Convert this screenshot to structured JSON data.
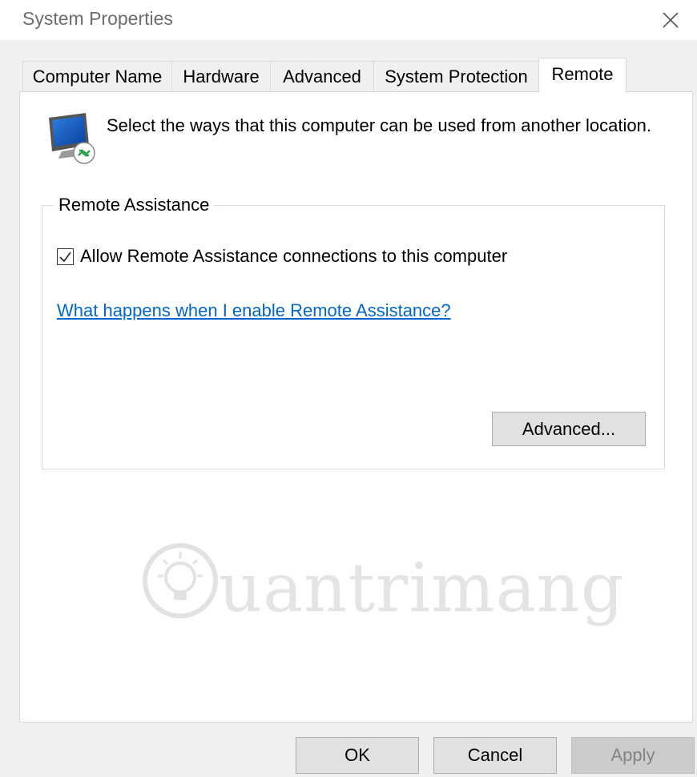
{
  "window": {
    "title": "System Properties"
  },
  "tabs": [
    {
      "label": "Computer Name",
      "active": false
    },
    {
      "label": "Hardware",
      "active": false
    },
    {
      "label": "Advanced",
      "active": false
    },
    {
      "label": "System Protection",
      "active": false
    },
    {
      "label": "Remote",
      "active": true
    }
  ],
  "intro": {
    "text": "Select the ways that this computer can be used from another location."
  },
  "remote_assistance": {
    "group_label": "Remote Assistance",
    "checkbox_label": "Allow Remote Assistance connections to this computer",
    "checked": true,
    "help_link": "What happens when I enable Remote Assistance?",
    "advanced_button": "Advanced..."
  },
  "watermark": {
    "text": "uantrimang"
  },
  "buttons": {
    "ok": "OK",
    "cancel": "Cancel",
    "apply": "Apply"
  },
  "colors": {
    "link": "#0066cc",
    "panel": "#ffffff",
    "background": "#f0f0f0",
    "disabled_text": "#838383"
  },
  "icons": {
    "close": "close-icon",
    "monitor": "remote-desktop-monitor-icon",
    "check": "checkmark-icon"
  }
}
